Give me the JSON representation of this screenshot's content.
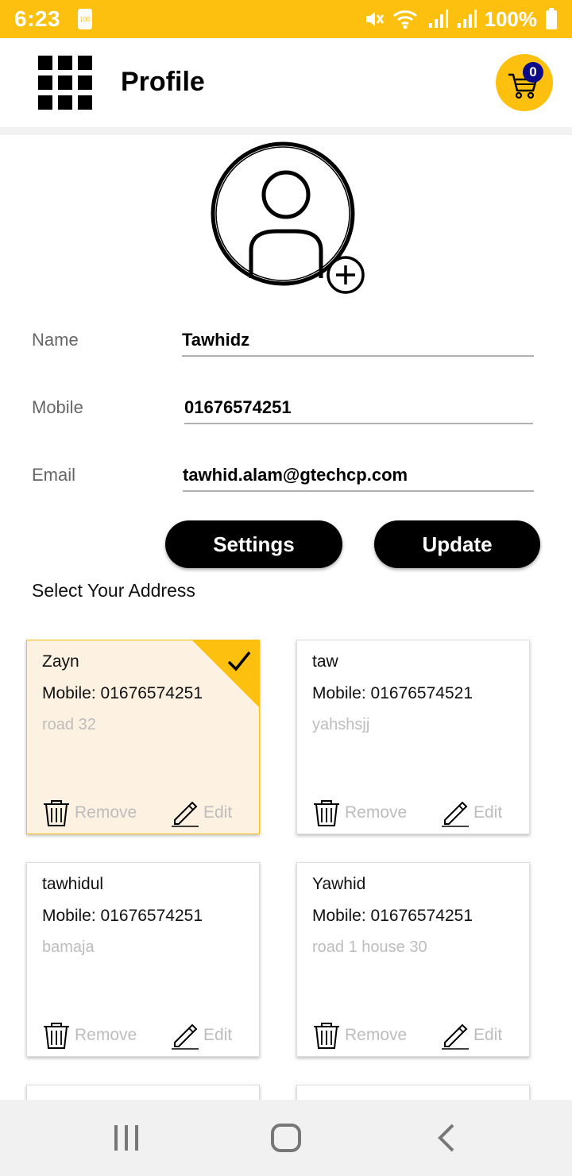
{
  "status_bar": {
    "time": "6:23",
    "small_battery_text": "100",
    "battery_percent": "100%",
    "background_color": "#fdc00f"
  },
  "app_bar": {
    "title": "Profile",
    "menu_icon": "grid-menu-icon",
    "cart_icon": "shopping-cart-icon",
    "cart_count": "0",
    "cart_badge_color": "#0b0b8a",
    "accent_color": "#fdc00f"
  },
  "profile": {
    "avatar_icon": "user-avatar-icon",
    "add_photo_icon": "plus-circle-icon",
    "fields": {
      "name": {
        "label": "Name",
        "value": "Tawhidz"
      },
      "mobile": {
        "label": "Mobile",
        "value": "01676574251"
      },
      "email": {
        "label": "Email",
        "value": "tawhid.alam@gtechcp.com"
      }
    },
    "settings_label": "Settings",
    "update_label": "Update"
  },
  "address_section": {
    "title": "Select Your Address",
    "remove_label": "Remove",
    "edit_label": "Edit",
    "selected_color": "#fdf1e2",
    "cards": [
      {
        "name": "Zayn",
        "mobile": "Mobile: 01676574251",
        "detail": "road 32",
        "selected": true
      },
      {
        "name": "taw",
        "mobile": "Mobile: 01676574521",
        "detail": "yahshsjj",
        "selected": false
      },
      {
        "name": "tawhidul",
        "mobile": "Mobile: 01676574251",
        "detail": "bamaja",
        "selected": false
      },
      {
        "name": "Yawhid",
        "mobile": "Mobile: 01676574251",
        "detail": "road 1 house 30",
        "selected": false
      }
    ]
  },
  "nav_bar": {
    "recents_icon": "recents-icon",
    "home_icon": "home-icon",
    "back_icon": "back-icon"
  }
}
